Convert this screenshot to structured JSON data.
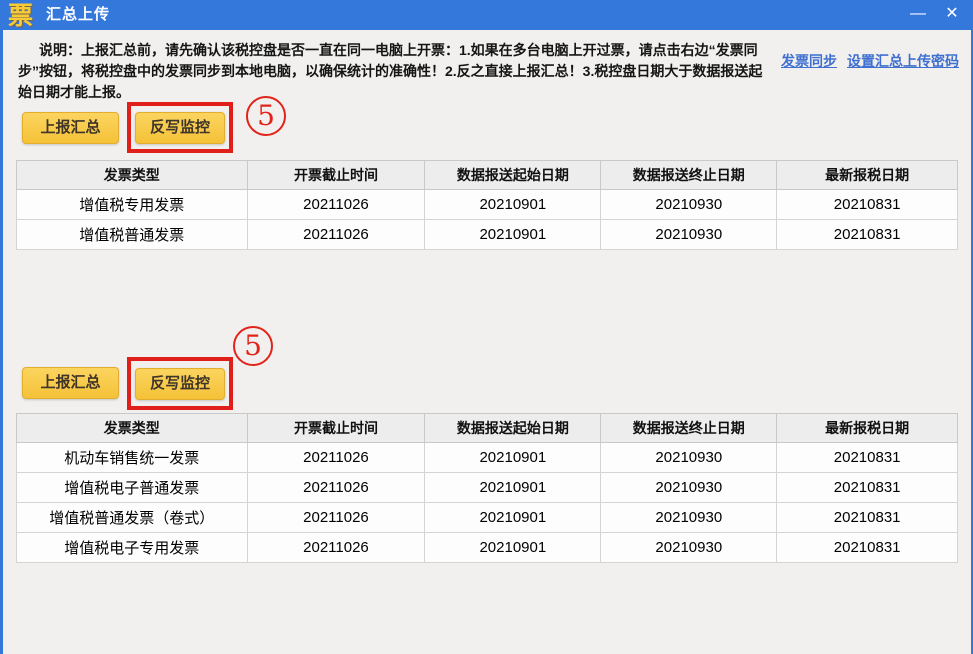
{
  "window": {
    "title": "汇总上传",
    "app_icon_glyph": "票",
    "minimize_glyph": "—",
    "close_glyph": "✕"
  },
  "colors": {
    "titlebar_blue": "#3578dc",
    "button_yellow": "#f5c238",
    "annotation_red": "#e01f1a",
    "link_blue": "#3e6fd1"
  },
  "note_text": "说明：上报汇总前，请先确认该税控盘是否一直在同一电脑上开票：1.如果在多台电脑上开过票，请点击右边“发票同步”按钮，将税控盘中的发票同步到本地电脑，以确保统计的准确性！2.反之直接上报汇总！3.税控盘日期大于数据报送起始日期才能上报。",
  "links": {
    "invoice_sync": "发票同步",
    "set_upload_password": "设置汇总上传密码"
  },
  "buttons": {
    "report_summary": "上报汇总",
    "writeback_monitor": "反写监控"
  },
  "annotation_number": "5",
  "sections": [
    {
      "table": {
        "headers": [
          "发票类型",
          "开票截止时间",
          "数据报送起始日期",
          "数据报送终止日期",
          "最新报税日期"
        ],
        "rows": [
          [
            "增值税专用发票",
            "20211026",
            "20210901",
            "20210930",
            "20210831"
          ],
          [
            "增值税普通发票",
            "20211026",
            "20210901",
            "20210930",
            "20210831"
          ]
        ]
      }
    },
    {
      "table": {
        "headers": [
          "发票类型",
          "开票截止时间",
          "数据报送起始日期",
          "数据报送终止日期",
          "最新报税日期"
        ],
        "rows": [
          [
            "机动车销售统一发票",
            "20211026",
            "20210901",
            "20210930",
            "20210831"
          ],
          [
            "增值税电子普通发票",
            "20211026",
            "20210901",
            "20210930",
            "20210831"
          ],
          [
            "增值税普通发票（卷式）",
            "20211026",
            "20210901",
            "20210930",
            "20210831"
          ],
          [
            "增值税电子专用发票",
            "20211026",
            "20210901",
            "20210930",
            "20210831"
          ]
        ]
      }
    }
  ]
}
